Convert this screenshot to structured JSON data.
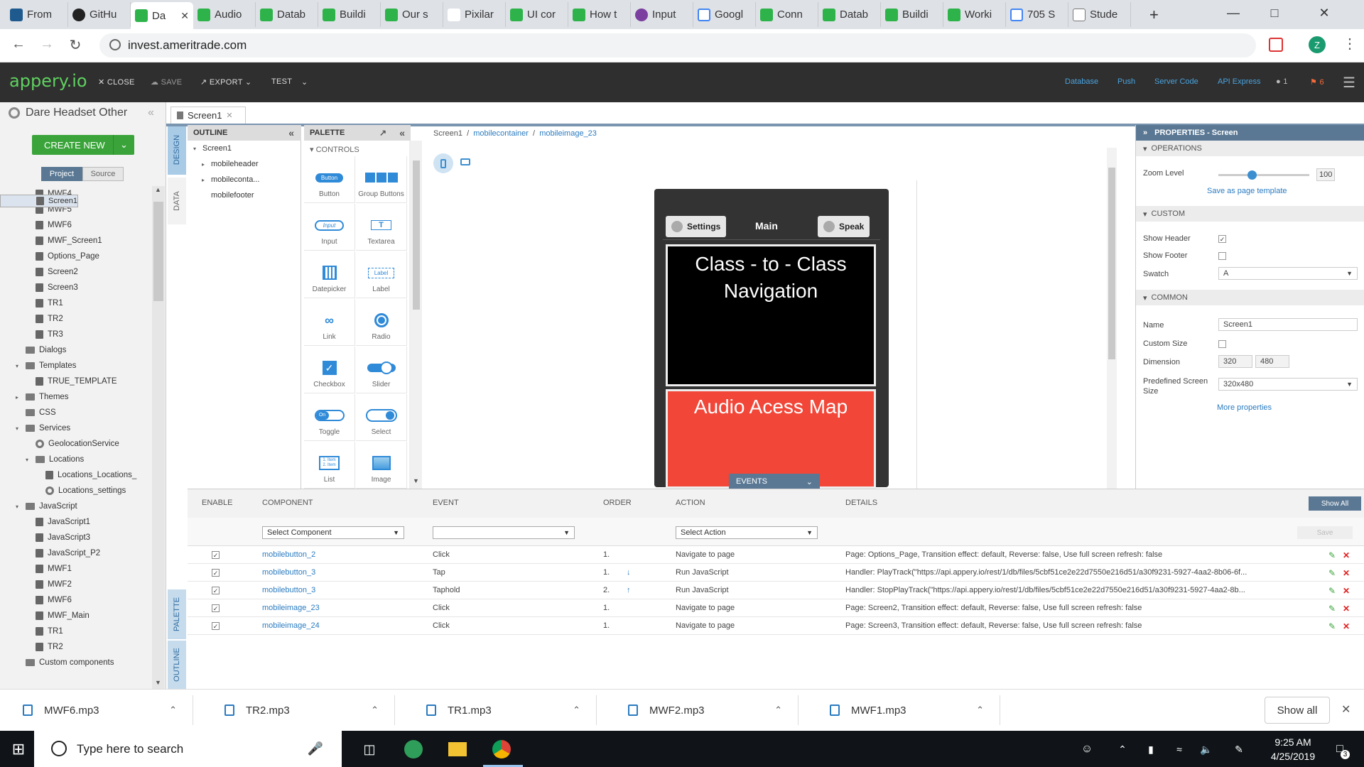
{
  "browser": {
    "tabs": [
      {
        "label": "From",
        "fav": "win"
      },
      {
        "label": "GitHu",
        "fav": "gh"
      },
      {
        "label": "Da",
        "fav": "g",
        "active": true
      },
      {
        "label": "Audio",
        "fav": "g"
      },
      {
        "label": "Datab",
        "fav": "g"
      },
      {
        "label": "Buildi",
        "fav": "g"
      },
      {
        "label": "Our s",
        "fav": "g"
      },
      {
        "label": "Pixilar",
        "fav": "px"
      },
      {
        "label": "UI cor",
        "fav": "g"
      },
      {
        "label": "How t",
        "fav": "g"
      },
      {
        "label": "Input",
        "fav": "io"
      },
      {
        "label": "Googl",
        "fav": "mp"
      },
      {
        "label": "Conn",
        "fav": "g"
      },
      {
        "label": "Datab",
        "fav": "g"
      },
      {
        "label": "Buildi",
        "fav": "g"
      },
      {
        "label": "Worki",
        "fav": "g"
      },
      {
        "label": "705 S",
        "fav": "mp"
      },
      {
        "label": "Stude",
        "fav": "doc"
      }
    ],
    "url": "invest.ameritrade.com",
    "profile_initial": "Z"
  },
  "app": {
    "logo": "appery.io",
    "toolbar": {
      "close": "CLOSE",
      "save": "SAVE",
      "export": "EXPORT",
      "test": "TEST"
    },
    "links": {
      "database": "Database",
      "push": "Push",
      "server_code": "Server Code",
      "api_express": "API Express"
    },
    "user_count": "1",
    "notif_count": "6"
  },
  "project": {
    "title": "Dare Headset Other",
    "create_new": "CREATE NEW",
    "tab_project": "Project",
    "tab_source": "Source",
    "tree": [
      {
        "label": "MWF4",
        "level": 2,
        "icon": "page"
      },
      {
        "label": "MWF5",
        "level": 2,
        "icon": "page"
      },
      {
        "label": "MWF6",
        "level": 2,
        "icon": "page"
      },
      {
        "label": "MWF_Screen1",
        "level": 2,
        "icon": "page"
      },
      {
        "label": "Options_Page",
        "level": 2,
        "icon": "page"
      },
      {
        "label": "Screen1",
        "level": 2,
        "icon": "page",
        "selected": true
      },
      {
        "label": "Screen2",
        "level": 2,
        "icon": "page"
      },
      {
        "label": "Screen3",
        "level": 2,
        "icon": "page"
      },
      {
        "label": "TR1",
        "level": 2,
        "icon": "page"
      },
      {
        "label": "TR2",
        "level": 2,
        "icon": "page"
      },
      {
        "label": "TR3",
        "level": 2,
        "icon": "page"
      },
      {
        "label": "Dialogs",
        "level": 1,
        "icon": "folder"
      },
      {
        "label": "Templates",
        "level": 1,
        "icon": "folder",
        "arrow": "▾"
      },
      {
        "label": "TRUE_TEMPLATE",
        "level": 2,
        "icon": "page"
      },
      {
        "label": "Themes",
        "level": 1,
        "icon": "folder",
        "arrow": "▸"
      },
      {
        "label": "CSS",
        "level": 1,
        "icon": "folder"
      },
      {
        "label": "Services",
        "level": 1,
        "icon": "folder",
        "arrow": "▾"
      },
      {
        "label": "GeolocationService",
        "level": 2,
        "icon": "svc"
      },
      {
        "label": "Locations",
        "level": 2,
        "icon": "folder",
        "arrow": "▾"
      },
      {
        "label": "Locations_Locations_",
        "level": 3,
        "icon": "page"
      },
      {
        "label": "Locations_settings",
        "level": 3,
        "icon": "svc"
      },
      {
        "label": "JavaScript",
        "level": 1,
        "icon": "folder",
        "arrow": "▾"
      },
      {
        "label": "JavaScript1",
        "level": 2,
        "icon": "page"
      },
      {
        "label": "JavaScript3",
        "level": 2,
        "icon": "page"
      },
      {
        "label": "JavaScript_P2",
        "level": 2,
        "icon": "page"
      },
      {
        "label": "MWF1",
        "level": 2,
        "icon": "page"
      },
      {
        "label": "MWF2",
        "level": 2,
        "icon": "page"
      },
      {
        "label": "MWF6",
        "level": 2,
        "icon": "page"
      },
      {
        "label": "MWF_Main",
        "level": 2,
        "icon": "page"
      },
      {
        "label": "TR1",
        "level": 2,
        "icon": "page"
      },
      {
        "label": "TR2",
        "level": 2,
        "icon": "page"
      },
      {
        "label": "Custom components",
        "level": 1,
        "icon": "folder"
      }
    ]
  },
  "sidetabs": {
    "design": "DESIGN",
    "data": "DATA",
    "palette": "PALETTE",
    "outline": "OUTLINE"
  },
  "editor": {
    "tab": "Screen1",
    "breadcrumb": [
      "Screen1",
      "mobilecontainer",
      "mobileimage_23"
    ]
  },
  "outline": {
    "title": "OUTLINE",
    "nodes": [
      {
        "label": "Screen1",
        "level": 0,
        "arrow": "▾"
      },
      {
        "label": "mobileheader",
        "level": 1,
        "arrow": "▸"
      },
      {
        "label": "mobileconta...",
        "level": 1,
        "arrow": "▸"
      },
      {
        "label": "mobilefooter",
        "level": 1,
        "arrow": ""
      }
    ]
  },
  "palette": {
    "title": "PALETTE",
    "section": "CONTROLS",
    "items": [
      {
        "label": "Button",
        "icon": "button-icon"
      },
      {
        "label": "Group Buttons",
        "icon": "group-buttons-icon"
      },
      {
        "label": "Input",
        "icon": "input-icon"
      },
      {
        "label": "Textarea",
        "icon": "textarea-icon"
      },
      {
        "label": "Datepicker",
        "icon": "datepicker-icon"
      },
      {
        "label": "Label",
        "icon": "label-icon"
      },
      {
        "label": "Link",
        "icon": "link-icon"
      },
      {
        "label": "Radio",
        "icon": "radio-icon"
      },
      {
        "label": "Checkbox",
        "icon": "checkbox-icon"
      },
      {
        "label": "Slider",
        "icon": "slider-icon"
      },
      {
        "label": "Toggle",
        "icon": "toggle-icon"
      },
      {
        "label": "Select",
        "icon": "select-icon"
      },
      {
        "label": "List",
        "icon": "list-icon"
      },
      {
        "label": "Image",
        "icon": "image-icon"
      }
    ],
    "icon_text": {
      "button": "Button",
      "input": "Input",
      "label": "Label",
      "toggle_on": "On",
      "list_1": "1. Item",
      "list_2": "2. Item"
    }
  },
  "phone": {
    "settings": "Settings",
    "header_title": "Main",
    "speak": "Speak",
    "block1_text": "Class - to - Class Navigation",
    "block2_text": "Audio Acess Map",
    "events_label": "EVENTS"
  },
  "properties": {
    "title": "PROPERTIES - Screen",
    "sections": {
      "operations": "OPERATIONS",
      "custom": "CUSTOM",
      "common": "COMMON"
    },
    "zoom_label": "Zoom Level",
    "zoom_value": "100",
    "zoom_fraction": 0.37,
    "save_template": "Save as page template",
    "show_header_label": "Show Header",
    "show_header": true,
    "show_footer_label": "Show Footer",
    "show_footer": false,
    "swatch_label": "Swatch",
    "swatch_value": "A",
    "name_label": "Name",
    "name_value": "Screen1",
    "custom_size_label": "Custom Size",
    "dimension_label": "Dimension",
    "dim_w": "320",
    "dim_h": "480",
    "predef_label": "Predefined Screen Size",
    "predef_value": "320x480",
    "more": "More properties"
  },
  "events": {
    "headers": {
      "enable": "ENABLE",
      "component": "COMPONENT",
      "event": "EVENT",
      "order": "ORDER",
      "action": "ACTION",
      "details": "DETAILS"
    },
    "show_all": "Show All",
    "select_component": "Select Component",
    "select_event": "",
    "select_action": "Select Action",
    "save": "Save",
    "rows": [
      {
        "component": "mobilebutton_2",
        "event": "Click",
        "order": "1.",
        "arrow": "",
        "action": "Navigate to page",
        "details": "Page: Options_Page, Transition effect: default, Reverse: false, Use full screen refresh: false"
      },
      {
        "component": "mobilebutton_3",
        "event": "Tap",
        "order": "1.",
        "arrow": "↓",
        "action": "Run JavaScript",
        "details": "Handler: PlayTrack(\"https://api.appery.io/rest/1/db/files/5cbf51ce2e22d7550e216d51/a30f9231-5927-4aa2-8b06-6f..."
      },
      {
        "component": "mobilebutton_3",
        "event": "Taphold",
        "order": "2.",
        "arrow": "↑",
        "action": "Run JavaScript",
        "details": "Handler: StopPlayTrack(\"https://api.appery.io/rest/1/db/files/5cbf51ce2e22d7550e216d51/a30f9231-5927-4aa2-8b..."
      },
      {
        "component": "mobileimage_23",
        "event": "Click",
        "order": "1.",
        "arrow": "",
        "action": "Navigate to page",
        "details": "Page: Screen2, Transition effect: default, Reverse: false, Use full screen refresh: false"
      },
      {
        "component": "mobileimage_24",
        "event": "Click",
        "order": "1.",
        "arrow": "",
        "action": "Navigate to page",
        "details": "Page: Screen3, Transition effect: default, Reverse: false, Use full screen refresh: false"
      }
    ]
  },
  "downloads": {
    "files": [
      "MWF6.mp3",
      "TR2.mp3",
      "TR1.mp3",
      "MWF2.mp3",
      "MWF1.mp3"
    ],
    "show_all": "Show all"
  },
  "taskbar": {
    "search_placeholder": "Type here to search",
    "time": "9:25 AM",
    "date": "4/25/2019",
    "notif_count": "3"
  },
  "colors": {
    "accent_green": "#3aa43a",
    "link_blue": "#2a7bc0",
    "header_dark": "#2f2f2f",
    "block_red": "#f14638"
  }
}
